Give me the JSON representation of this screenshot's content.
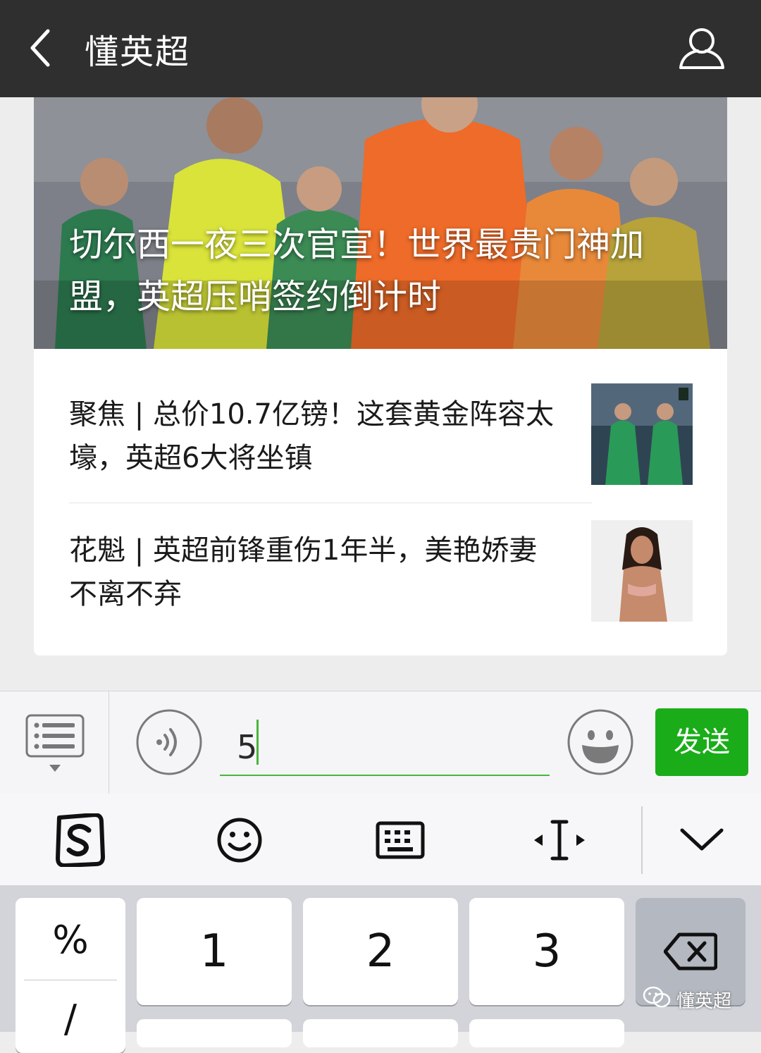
{
  "nav": {
    "title": "懂英超"
  },
  "hero": {
    "title": "切尔西一夜三次官宣！世界最贵门神加盟，英超压哨签约倒计时"
  },
  "articles": [
    {
      "title": "聚焦 | 总价10.7亿镑！这套黄金阵容太壕，英超6大将坐镇",
      "thumb": "goalkeepers-photo"
    },
    {
      "title": "花魁 | 英超前锋重伤1年半，美艳娇妻不离不弃",
      "thumb": "woman-photo"
    }
  ],
  "input": {
    "value": "5",
    "send_label": "发送"
  },
  "keyboard": {
    "sym_keys": [
      "%",
      "/"
    ],
    "number_keys": [
      "1",
      "2",
      "3"
    ]
  },
  "watermark": {
    "text": "懂英超"
  },
  "colors": {
    "nav_bg": "#2f2f2f",
    "send_bg": "#1aad19",
    "caret": "#49b63c"
  },
  "icons": [
    "back-chevron-icon",
    "profile-icon",
    "menu-list-icon",
    "voice-icon",
    "emoji-icon",
    "sogou-icon",
    "smiley-icon",
    "keyboard-icon",
    "cursor-move-icon",
    "collapse-chevron-icon",
    "backspace-icon"
  ]
}
